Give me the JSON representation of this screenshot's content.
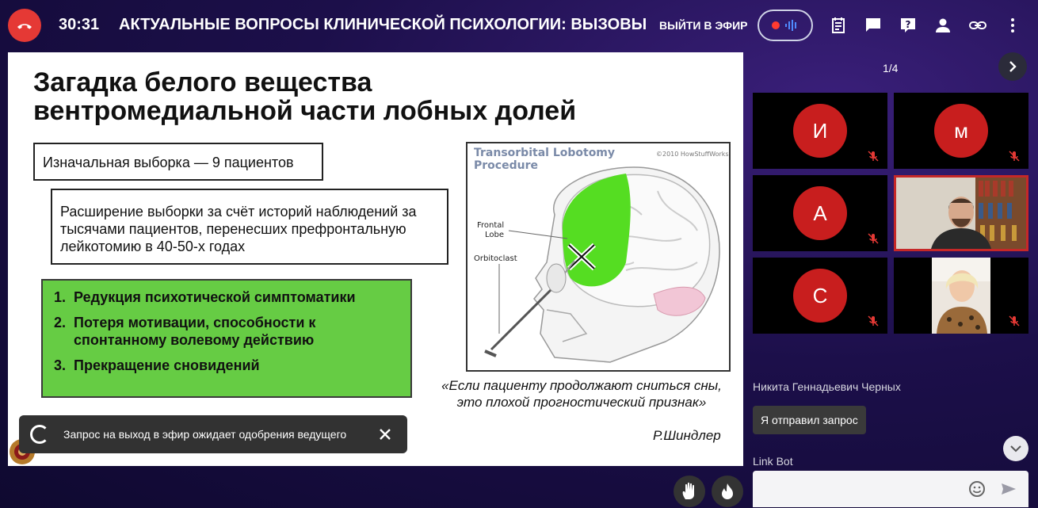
{
  "header": {
    "timer": "30:31",
    "title": "АКТУАЛЬНЫЕ ВОПРОСЫ КЛИНИЧЕСКОЙ ПСИХОЛОГИИ: ВЫЗОВЫ",
    "go_live_label": "ВЫЙТИ В ЭФИР",
    "icons": [
      "hangup-icon",
      "record-icon",
      "notes-icon",
      "chat-icon",
      "help-icon",
      "user-icon",
      "link-icon",
      "more-icon"
    ]
  },
  "slide": {
    "title": "Загадка белого вещества вентромедиальной части лобных долей",
    "box1": "Изначальная выборка — 9 пациентов",
    "box2": "Расширение выборки за счёт историй наблюдений за тысячами пациентов, перенесших префронтальную лейкотомию в 40-50-х годах",
    "list": [
      {
        "num": "1.",
        "text": "Редукция психотической симптоматики"
      },
      {
        "num": "2.",
        "text": "Потеря мотивации, способности к спонтанному волевому действию"
      },
      {
        "num": "3.",
        "text": "Прекращение сновидений"
      }
    ],
    "image": {
      "title_line1": "Transorbital Lobotomy",
      "title_line2": "Procedure",
      "copyright": "©2010 HowStuffWorks",
      "label_frontal1": "Frontal",
      "label_frontal2": "Lobe",
      "label_orbitoclast": "Orbitoclast"
    },
    "quote": "«Если пациенту продолжают сниться сны, это плохой прогностический признак»",
    "author": "Р.Шиндлер"
  },
  "toast": {
    "text": "Запрос на выход в эфир ожидает одобрения ведущего"
  },
  "panel": {
    "pager": "1/4",
    "participants": [
      {
        "initial": "И"
      },
      {
        "initial": "м"
      },
      {
        "initial": "А"
      },
      {
        "initial": ""
      },
      {
        "initial": "С"
      },
      {
        "initial": ""
      }
    ]
  },
  "chat": {
    "sender": "Никита Геннадьевич Черных",
    "message": "Я отправил запрос",
    "bot_name": "Link Bot",
    "input_value": ""
  },
  "colors": {
    "hangup": "#e53935",
    "avatar": "#c81e1e",
    "green_box": "#66cc44",
    "brain_green": "#55dd22"
  }
}
